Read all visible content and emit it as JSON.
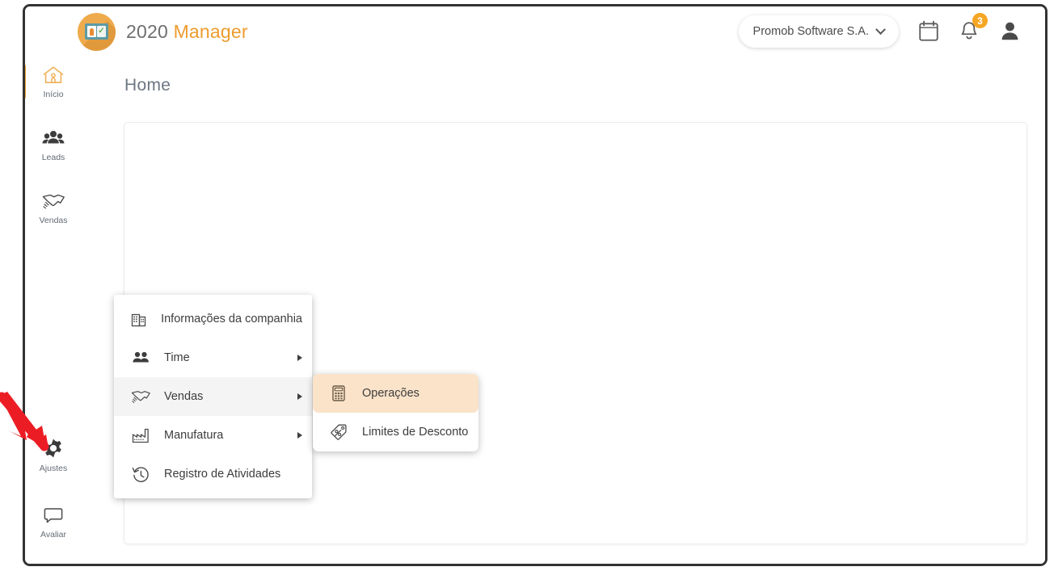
{
  "app": {
    "brand_first": "2020",
    "brand_second": "Manager",
    "brand_accent_color": "#ee9c2e"
  },
  "topbar": {
    "company": "Promob Software S.A.",
    "chevron_icon": "chevron-down-icon",
    "calendar_icon": "calendar-icon",
    "notifications_icon": "bell-icon",
    "notifications_count": "3",
    "notifications_badge_color": "#f5a623",
    "avatar_icon": "user-avatar-icon"
  },
  "sidebar": {
    "items": [
      {
        "label": "Início",
        "icon": "home-icon",
        "active": true
      },
      {
        "label": "Leads",
        "icon": "people-icon",
        "active": false
      },
      {
        "label": "Vendas",
        "icon": "handshake-icon",
        "active": false
      },
      {
        "label": "Ajustes",
        "icon": "gear-icon",
        "active": false
      },
      {
        "label": "Avaliar",
        "icon": "speech-bubble-icon",
        "active": false
      }
    ],
    "active_indicator_color": "#f0a32e"
  },
  "main": {
    "page_title": "Home"
  },
  "menu_primary": {
    "items": [
      {
        "label": "Informações da companhia",
        "icon": "building-icon",
        "has_submenu": false,
        "highlighted": false
      },
      {
        "label": "Time",
        "icon": "people-icon",
        "has_submenu": true,
        "highlighted": false
      },
      {
        "label": "Vendas",
        "icon": "handshake-icon",
        "has_submenu": true,
        "highlighted": true
      },
      {
        "label": "Manufatura",
        "icon": "factory-icon",
        "has_submenu": true,
        "highlighted": false
      },
      {
        "label": "Registro de Atividades",
        "icon": "history-clock-icon",
        "has_submenu": false,
        "highlighted": false
      }
    ]
  },
  "menu_secondary": {
    "items": [
      {
        "label": "Operações",
        "icon": "calculator-icon",
        "selected": true
      },
      {
        "label": "Limites de Desconto",
        "icon": "discount-tag-icon",
        "selected": false
      }
    ],
    "selected_background": "#fae3c9"
  },
  "annotation": {
    "arrow_color": "#ec1c24",
    "points_to": "sidebar-item-ajustes"
  }
}
